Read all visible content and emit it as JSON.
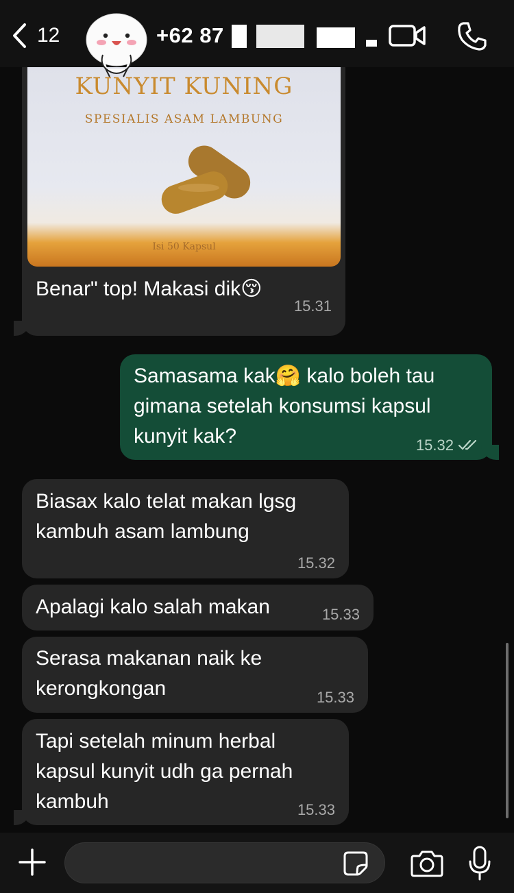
{
  "header": {
    "back_count": "12",
    "contact_name": "+62 87",
    "icons": [
      "back-chevron-icon",
      "video-call-icon",
      "phone-call-icon"
    ]
  },
  "product_photo": {
    "brand": "KUNYIT KUNING",
    "subtitle": "SPESIALIS ASAM LAMBUNG",
    "count": "Isi 50 Kapsul"
  },
  "messages": [
    {
      "direction": "in",
      "text": "Benar\" top! Makasi dik😚",
      "time": "15.31"
    },
    {
      "direction": "out",
      "text": "Samasama kak🤗 kalo boleh tau\ngimana setelah konsumsi kapsul\nkunyit kak?",
      "time": "15.32",
      "status": "read"
    },
    {
      "direction": "in",
      "text": "Biasax kalo telat makan lgsg\nkambuh asam lambung",
      "time": "15.32"
    },
    {
      "direction": "in",
      "text": "Apalagi kalo salah makan",
      "time": "15.33"
    },
    {
      "direction": "in",
      "text": "Serasa makanan naik ke\nkerongkongan",
      "time": "15.33"
    },
    {
      "direction": "in",
      "text": "Tapi setelah minum herbal\nkapsul kunyit udh ga pernah\nkambuh",
      "time": "15.33"
    }
  ],
  "composer": {
    "placeholder": "",
    "icons": [
      "plus-icon",
      "sticker-icon",
      "camera-icon",
      "microphone-icon"
    ]
  },
  "colors": {
    "incoming_bubble": "#262626",
    "outgoing_bubble": "#144d37",
    "background": "#0b0b0b",
    "header": "#121212"
  }
}
